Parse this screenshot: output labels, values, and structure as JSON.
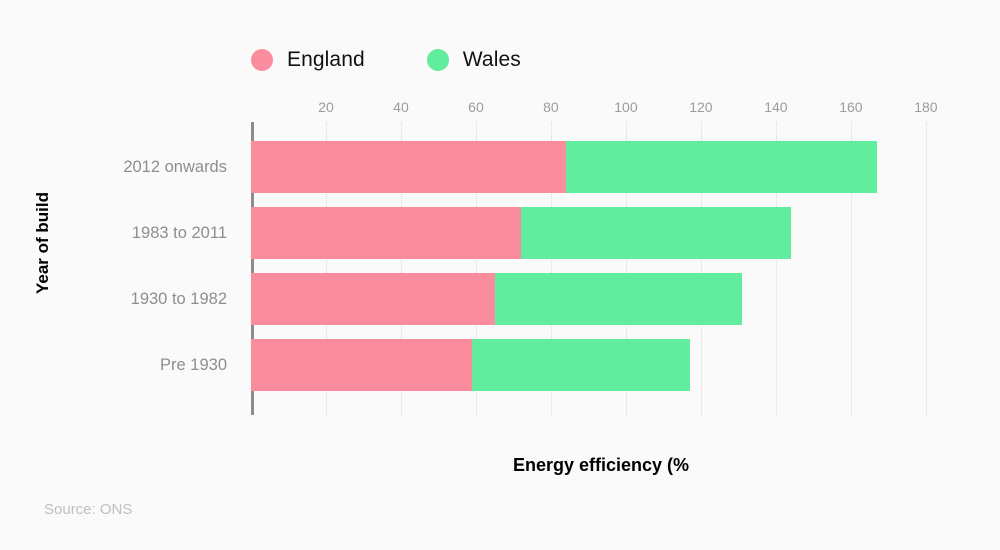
{
  "legend": {
    "position": "top-left",
    "items": [
      {
        "label": "England",
        "color": "#fb8c9d",
        "swatch": "circle-swatch"
      },
      {
        "label": "Wales",
        "color": "#62ec9d",
        "swatch": "circle-swatch"
      }
    ]
  },
  "source_note": "Source: ONS",
  "colors": {
    "england": "#fb8c9d",
    "wales": "#62ec9d",
    "background": "#fafafa",
    "axis": "#8c8c8c",
    "gridline": "#d8d8d8",
    "tick_text": "#9c9c9c",
    "category_text": "#8e8e8e",
    "title_text": "#000000",
    "source_text": "#bfbfbf"
  },
  "chart_data": {
    "type": "bar",
    "orientation": "horizontal",
    "stacked": true,
    "title": "",
    "subtitle": "",
    "xlabel": "Energy efficiency (%",
    "ylabel": "Year of build",
    "categories": [
      "2012 onwards",
      "1983 to 2011",
      "1930 to 1982",
      "Pre 1930"
    ],
    "series": [
      {
        "name": "England",
        "color": "#fb8c9d",
        "values": [
          84,
          72,
          65,
          59
        ]
      },
      {
        "name": "Wales",
        "color": "#62ec9d",
        "values": [
          83,
          72,
          66,
          58
        ]
      }
    ],
    "totals": [
      167,
      144,
      131,
      117
    ],
    "xlim": [
      0,
      186.7
    ],
    "xticks": [
      20,
      40,
      60,
      80,
      100,
      120,
      140,
      160,
      180
    ],
    "xtick_labels": [
      "20",
      "40",
      "60",
      "80",
      "100",
      "120",
      "140",
      "160",
      "180"
    ],
    "grid": {
      "vertical": true,
      "horizontal": false,
      "style": "dotted"
    },
    "legend_position": "top-left",
    "annotations": []
  }
}
